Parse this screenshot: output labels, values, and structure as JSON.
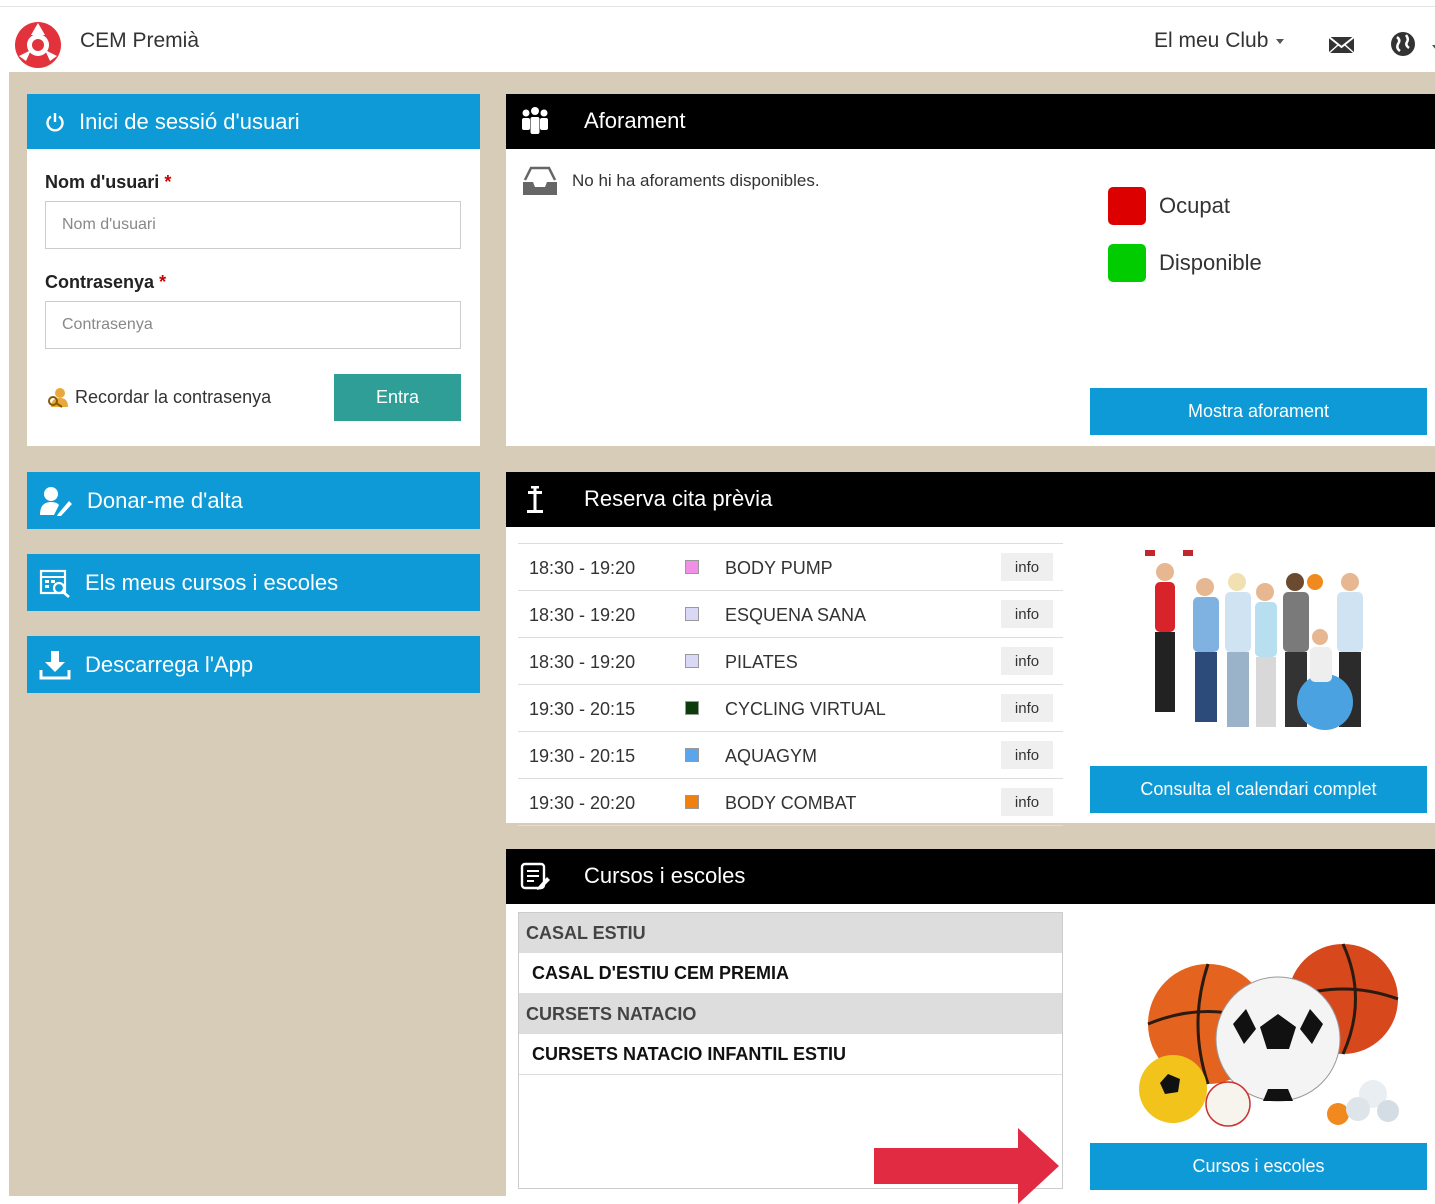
{
  "header": {
    "brand": "CEM Premià",
    "club_menu": "El meu Club"
  },
  "login": {
    "title": "Inici de sessió d'usuari",
    "username_label": "Nom d'usuari",
    "username_placeholder": "Nom d'usuari",
    "password_label": "Contrasenya",
    "password_placeholder": "Contrasenya",
    "required_mark": "*",
    "remember": "Recordar la contrasenya",
    "submit": "Entra"
  },
  "side_buttons": {
    "signup": "Donar-me d'alta",
    "my_courses": "Els meus cursos i escoles",
    "download_app": "Descarrega l'App"
  },
  "capacity": {
    "title": "Aforament",
    "empty": "No hi ha aforaments disponibles.",
    "legend_busy": "Ocupat",
    "legend_free": "Disponible",
    "busy_color": "#dd0000",
    "free_color": "#00cc00",
    "button": "Mostra aforament"
  },
  "booking": {
    "title": "Reserva cita prèvia",
    "info_label": "info",
    "button": "Consulta el calendari complet",
    "classes": [
      {
        "time": "18:30 - 19:20",
        "name": "BODY PUMP",
        "color": "#f18ee6"
      },
      {
        "time": "18:30 - 19:20",
        "name": "ESQUENA SANA",
        "color": "#d9d9f7"
      },
      {
        "time": "18:30 - 19:20",
        "name": "PILATES",
        "color": "#d9d9f7"
      },
      {
        "time": "19:30 - 20:15",
        "name": "CYCLING VIRTUAL",
        "color": "#0a3d0a"
      },
      {
        "time": "19:30 - 20:15",
        "name": "AQUAGYM",
        "color": "#5aa6ec"
      },
      {
        "time": "19:30 - 20:20",
        "name": "BODY COMBAT",
        "color": "#f08010"
      }
    ]
  },
  "courses": {
    "title": "Cursos i escoles",
    "cat1": "CASAL ESTIU",
    "item1": "CASAL D'ESTIU CEM PREMIA",
    "cat2": "CURSETS NATACIO",
    "item2": "CURSETS NATACIO INFANTIL ESTIU",
    "button": "Cursos i escoles"
  }
}
